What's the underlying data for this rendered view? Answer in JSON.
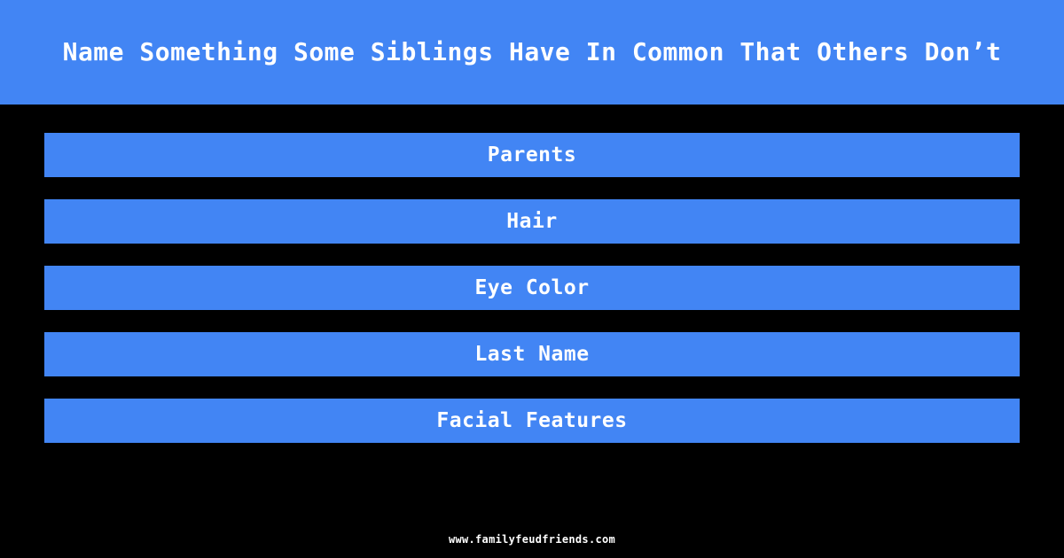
{
  "theme": {
    "background_color": "#000000",
    "accent_color": "#4285f4",
    "text_color": "#ffffff"
  },
  "header": {
    "title": "Name Something Some Siblings Have In Common That Others Don’t"
  },
  "answers": {
    "items": [
      {
        "rank": 1,
        "label": "Parents"
      },
      {
        "rank": 2,
        "label": "Hair"
      },
      {
        "rank": 3,
        "label": "Eye Color"
      },
      {
        "rank": 4,
        "label": "Last Name"
      },
      {
        "rank": 5,
        "label": "Facial Features"
      }
    ]
  },
  "footer": {
    "url": "www.familyfeudfriends.com"
  }
}
